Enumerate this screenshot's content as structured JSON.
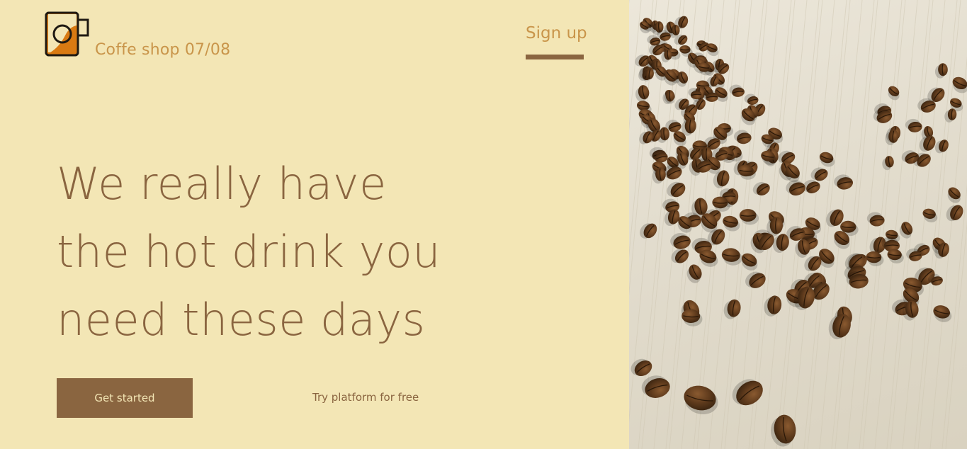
{
  "header": {
    "brand": "Coffe shop 07/08",
    "logo_icon": "coffee-mug-icon",
    "signup_label": "Sign up"
  },
  "hero": {
    "headline_lines": [
      "We really have",
      "the hot drink you",
      "need these days"
    ],
    "cta_label": "Get started",
    "secondary_link": "Try platform for free"
  },
  "image": {
    "subject": "coffee beans on a light wooden table"
  },
  "colors": {
    "background": "#f3e6b5",
    "accent": "#8a6540",
    "brand_text": "#c9954a",
    "mug_fill": "#d97a12"
  }
}
